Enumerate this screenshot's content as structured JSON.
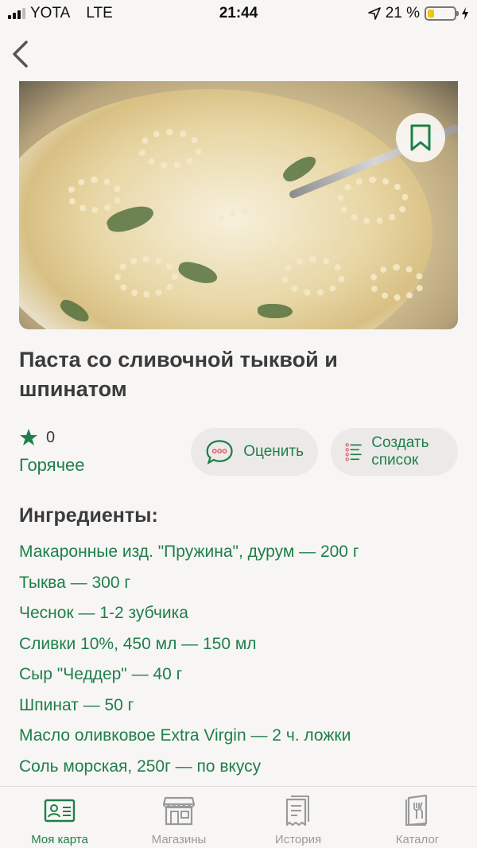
{
  "status_bar": {
    "carrier": "YOTA",
    "network": "LTE",
    "time": "21:44",
    "battery": "21 %"
  },
  "recipe": {
    "title": "Паста со сливочной тыквой и шпинатом",
    "rating": "0",
    "tag": "Горячее",
    "rate_label": "Оценить",
    "list_label": "Создать список"
  },
  "ingredients": {
    "title": "Ингредиенты:",
    "items": [
      "Макаронные изд. \"Пружина\", дурум — 200 г",
      "Тыква — 300 г",
      "Чеснок — 1-2 зубчика",
      "Сливки 10%, 450 мл — 150 мл",
      "Сыр \"Чеддер\" — 40 г",
      "Шпинат — 50 г",
      "Масло оливковое Extra Virgin — 2 ч. ложки",
      "Соль морская, 250г — по вкусу"
    ]
  },
  "tabs": [
    {
      "label": "Моя карта",
      "icon": "card-icon"
    },
    {
      "label": "Магазины",
      "icon": "store-icon"
    },
    {
      "label": "История",
      "icon": "receipt-icon"
    },
    {
      "label": "Каталог",
      "icon": "catalog-icon"
    }
  ],
  "colors": {
    "accent": "#1e7f4a",
    "background": "#f8f6f4",
    "inactive": "#9a9a9a"
  }
}
